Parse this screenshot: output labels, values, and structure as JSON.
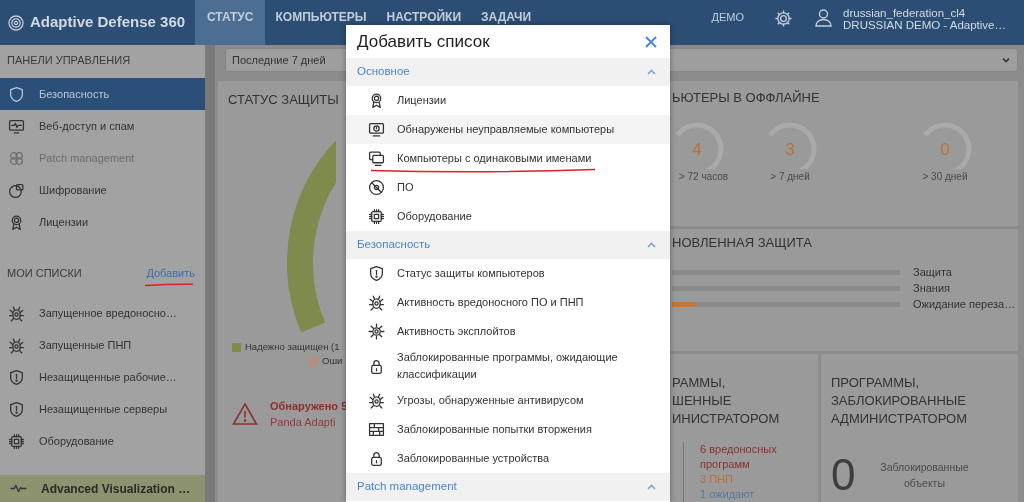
{
  "navbar": {
    "brand": "Adaptive Defense 360",
    "tabs": [
      {
        "label": "СТАТУС",
        "selected": true
      },
      {
        "label": "КОМПЬЮТЕРЫ",
        "selected": false
      },
      {
        "label": "НАСТРОЙКИ",
        "selected": false
      },
      {
        "label": "ЗАДАЧИ",
        "selected": false
      }
    ],
    "account": "ДЕМО",
    "user_name": "drussian_federation_cl4",
    "user_org": "DRUSSIAN DEMO - Adaptive…"
  },
  "sidebar": {
    "dashboards_title": "ПАНЕЛИ УПРАВЛЕНИЯ",
    "dashboards": [
      {
        "label": "Безопасность",
        "selected": true,
        "disabled": false
      },
      {
        "label": "Веб-доступ и спам",
        "selected": false,
        "disabled": false
      },
      {
        "label": "Patch management",
        "selected": false,
        "disabled": true
      },
      {
        "label": "Шифрование",
        "selected": false,
        "disabled": false
      },
      {
        "label": "Лицензии",
        "selected": false,
        "disabled": false
      }
    ],
    "lists_title": "МОИ СПИСКИ",
    "add_link": {
      "label": "Добавить",
      "underlined": true
    },
    "lists": [
      {
        "label": "Запущенное вредоносно…"
      },
      {
        "label": "Запущенные ПНП"
      },
      {
        "label": "Незащищенные рабочие…"
      },
      {
        "label": "Незащищенные серверы"
      },
      {
        "label": "Оборудование"
      }
    ],
    "footer": "Advanced Visualization …"
  },
  "dashboard": {
    "period": "Последние 7 дней",
    "status_card": {
      "title": "СТАТУС ЗАЩИТЫ",
      "legend": [
        {
          "label": "Надежно защищен (1",
          "color": "#7f8b4c"
        },
        {
          "label": "Оши",
          "color": "#b58f7c"
        }
      ],
      "alert_title": "Обнаружено 5",
      "alert_text": "Panda Adapti"
    },
    "offline_card": {
      "title": "ЬЮТЕРЫ В ОФФЛАЙНЕ",
      "gauges": [
        {
          "value": "4",
          "caption": "> 72 часов"
        },
        {
          "value": "3",
          "caption": "> 7 дней"
        },
        {
          "value": "0",
          "caption": "> 30 дней"
        }
      ]
    },
    "protection_card": {
      "title": "НОВЛЕННАЯ ЗАЩИТА",
      "bars": [
        {
          "label": "Защита",
          "kind": "plain"
        },
        {
          "label": "Знания",
          "kind": "plain"
        },
        {
          "label": "Ожидание переза…",
          "kind": "pending"
        }
      ]
    },
    "allowed_card": {
      "title": "РАММЫ,\nШЕННЫЕ\nИНИСТРАТОРОМ",
      "lines": [
        {
          "text": "6 вредоносных программ",
          "color": "#8e2f2f"
        },
        {
          "text": "3 ПНП",
          "color": "#b5723a"
        },
        {
          "text": "1 ожидают",
          "color": "#5a78a0"
        }
      ]
    },
    "blocked_card": {
      "title": "ПРОГРАММЫ, ЗАБЛОКИРОВАННЫЕ АДМИНИСТРАТОРОМ",
      "count": "0",
      "caption": "Заблокированные объекты"
    }
  },
  "modal": {
    "title": "Добавить список",
    "sections": [
      {
        "title": "Основное",
        "expanded": true,
        "items": [
          {
            "label": "Лицензии",
            "highlighted": false,
            "underlined": false
          },
          {
            "label": "Обнаружены неуправляемые компьютеры",
            "highlighted": true,
            "underlined": false
          },
          {
            "label": "Компьютеры с одинаковыми именами",
            "highlighted": false,
            "underlined": true
          },
          {
            "label": "ПО",
            "highlighted": false,
            "underlined": false
          },
          {
            "label": "Оборудование",
            "highlighted": false,
            "underlined": false
          }
        ]
      },
      {
        "title": "Безопасность",
        "expanded": true,
        "items": [
          {
            "label": "Статус защиты компьютеров",
            "highlighted": false,
            "underlined": false
          },
          {
            "label": "Активность вредоносного ПО и ПНП",
            "highlighted": false,
            "underlined": false
          },
          {
            "label": "Активность эксплойтов",
            "highlighted": false,
            "underlined": false
          },
          {
            "label": "Заблокированные программы, ожидающие классификации",
            "highlighted": false,
            "underlined": false
          },
          {
            "label": "Угрозы, обнаруженные антивирусом",
            "highlighted": false,
            "underlined": false
          },
          {
            "label": "Заблокированные попытки вторжения",
            "highlighted": false,
            "underlined": false
          },
          {
            "label": "Заблокированные устройства",
            "highlighted": false,
            "underlined": false
          }
        ]
      },
      {
        "title": "Patch management",
        "expanded": true
      }
    ]
  }
}
